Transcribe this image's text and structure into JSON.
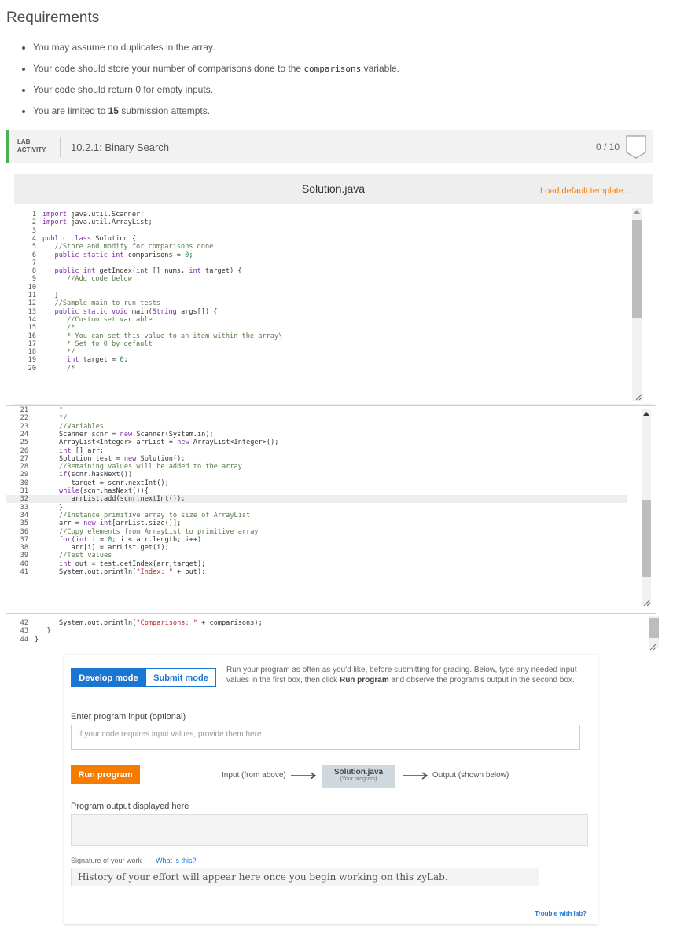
{
  "requirements": {
    "heading": "Requirements",
    "items": [
      {
        "text": "You may assume no duplicates in the array."
      },
      {
        "pre": "Your code should store your number of comparisons done to the ",
        "code": "comparisons",
        "post": " variable."
      },
      {
        "text": "Your code should return 0 for empty inputs."
      },
      {
        "pre": "You are limited to ",
        "bold": "15",
        "post": " submission attempts."
      }
    ]
  },
  "lab": {
    "tag_line1": "LAB",
    "tag_line2": "ACTIVITY",
    "title": "10.2.1: Binary Search",
    "score": "0 / 10"
  },
  "editor": {
    "file_name": "Solution.java",
    "load_template": "Load default template..."
  },
  "code": [
    {
      "n": "1",
      "t": "import java.util.Scanner;"
    },
    {
      "n": "2",
      "t": "import java.util.ArrayList;"
    },
    {
      "n": "3",
      "t": ""
    },
    {
      "n": "4",
      "t": "public class Solution {"
    },
    {
      "n": "5",
      "t": "   //Store and modify for comparisons done"
    },
    {
      "n": "6",
      "t": "   public static int comparisons = 0;"
    },
    {
      "n": "7",
      "t": ""
    },
    {
      "n": "8",
      "t": "   public int getIndex(int [] nums, int target) {"
    },
    {
      "n": "9",
      "t": "      //Add code below"
    },
    {
      "n": "10",
      "t": ""
    },
    {
      "n": "11",
      "t": "   }"
    },
    {
      "n": "12",
      "t": "   //Sample main to run tests"
    },
    {
      "n": "13",
      "t": "   public static void main(String args[]) {"
    },
    {
      "n": "14",
      "t": "      //Custom set variable"
    },
    {
      "n": "15",
      "t": "      /*"
    },
    {
      "n": "16",
      "t": "      * You can set this value to an item within the array\\"
    },
    {
      "n": "17",
      "t": "      * Set to 0 by default"
    },
    {
      "n": "18",
      "t": "      */"
    },
    {
      "n": "19",
      "t": "      int target = 0;"
    },
    {
      "n": "20",
      "t": "      /*"
    },
    {
      "n": "21",
      "t": "      *"
    },
    {
      "n": "22",
      "t": "      */"
    },
    {
      "n": "23",
      "t": "      //Variables"
    },
    {
      "n": "24",
      "t": "      Scanner scnr = new Scanner(System.in);"
    },
    {
      "n": "25",
      "t": "      ArrayList<Integer> arrList = new ArrayList<Integer>();"
    },
    {
      "n": "26",
      "t": "      int [] arr;"
    },
    {
      "n": "27",
      "t": "      Solution test = new Solution();"
    },
    {
      "n": "28",
      "t": "      //Remaining values will be added to the array"
    },
    {
      "n": "29",
      "t": "      if(scnr.hasNext())"
    },
    {
      "n": "30",
      "t": "         target = scnr.nextInt();"
    },
    {
      "n": "31",
      "t": "      while(scnr.hasNext()){"
    },
    {
      "n": "32",
      "t": "         arrList.add(scnr.nextInt());"
    },
    {
      "n": "33",
      "t": "      }"
    },
    {
      "n": "34",
      "t": "      //Instance primitive array to size of ArrayList"
    },
    {
      "n": "35",
      "t": "      arr = new int[arrList.size()];"
    },
    {
      "n": "36",
      "t": "      //Copy elements from ArrayList to primitive array"
    },
    {
      "n": "37",
      "t": "      for(int i = 0; i < arr.length; i++)"
    },
    {
      "n": "38",
      "t": "         arr[i] = arrList.get(i);"
    },
    {
      "n": "39",
      "t": "      //Test values"
    },
    {
      "n": "40",
      "t": "      int out = test.getIndex(arr,target);"
    },
    {
      "n": "41",
      "t": "      System.out.println(\"Index: \" + out);"
    },
    {
      "n": "42",
      "t": "      System.out.println(\"Comparisons: \" + comparisons);"
    },
    {
      "n": "43",
      "t": "   }"
    },
    {
      "n": "44",
      "t": "}"
    }
  ],
  "develop": {
    "develop_mode": "Develop mode",
    "submit_mode": "Submit mode",
    "desc_pre": "Run your program as often as you'd like, before submitting for grading. Below, type any needed input values in the first box, then click ",
    "desc_bold": "Run program",
    "desc_post": " and observe the program's output in the second box.",
    "input_label": "Enter program input (optional)",
    "input_placeholder": "If your code requires input values, provide them here.",
    "run_button": "Run program",
    "flow_input": "Input (from above)",
    "flow_file": "Solution.java",
    "flow_file_sub": "(Your program)",
    "flow_output": "Output (shown below)",
    "output_label": "Program output displayed here",
    "signature_label": "Signature of your work",
    "what_is_this": "What is this?",
    "history_text": "History of your effort will appear here once you begin working on this zyLab.",
    "trouble": "Trouble with lab?"
  },
  "colors": {
    "accent_blue": "#1976d2",
    "run_orange": "#f57c00",
    "lab_green": "#4caf50"
  }
}
